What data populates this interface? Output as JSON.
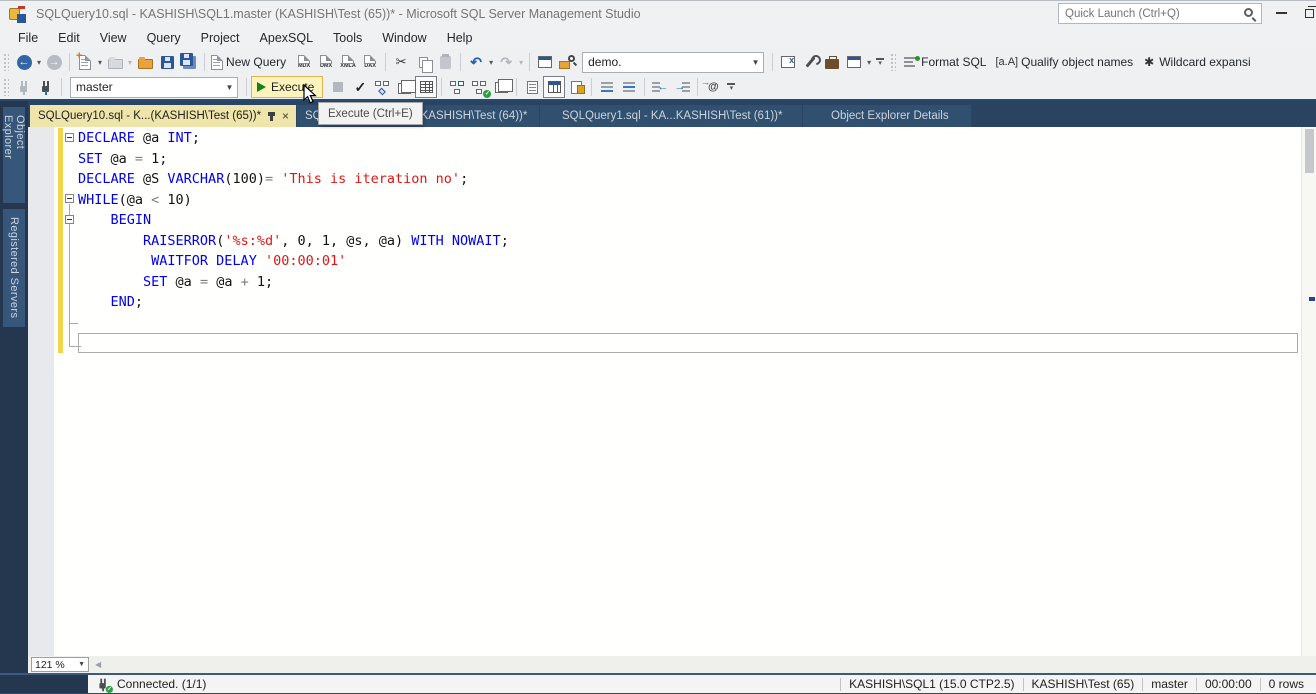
{
  "window": {
    "title": "SQLQuery10.sql - KASHISH\\SQL1.master (KASHISH\\Test (65))* - Microsoft SQL Server Management Studio",
    "quick_launch_placeholder": "Quick Launch (Ctrl+Q)"
  },
  "menu": {
    "items": [
      "File",
      "Edit",
      "View",
      "Query",
      "Project",
      "ApexSQL",
      "Tools",
      "Window",
      "Help"
    ]
  },
  "toolbar1": {
    "new_query": "New Query",
    "query_types": [
      "MDX",
      "DMX",
      "XMLA",
      "DAX"
    ],
    "database_value": "demo.",
    "format_sql": "Format SQL",
    "qualify_icon": "[a.A]",
    "qualify": "Qualify object names",
    "wildcard_icon": "✱",
    "wildcard": "Wildcard expansi"
  },
  "toolbar2": {
    "database_value": "master",
    "execute": "Execute"
  },
  "tooltip": {
    "text": "Execute (Ctrl+E)"
  },
  "tabs": {
    "active": "SQLQuery10.sql - K...(KASHISH\\Test (65))*",
    "tab2_start": "SQ",
    "tab2_end": "KASHISH\\Test (64))*",
    "tab3": "SQLQuery1.sql - KA...KASHISH\\Test (61))*",
    "tab4": "Object Explorer Details"
  },
  "sidebar": {
    "items": [
      "Object Explorer",
      "Registered Servers"
    ]
  },
  "editor": {
    "lines": [
      [
        {
          "c": "k",
          "t": "DECLARE"
        },
        {
          "c": "p",
          "t": " @a "
        },
        {
          "c": "k",
          "t": "INT"
        },
        {
          "c": "p",
          "t": ";"
        }
      ],
      [
        {
          "c": "k",
          "t": "SET"
        },
        {
          "c": "p",
          "t": " @a "
        },
        {
          "c": "o",
          "t": "="
        },
        {
          "c": "p",
          "t": " 1;"
        }
      ],
      [
        {
          "c": "k",
          "t": "DECLARE"
        },
        {
          "c": "p",
          "t": " @S "
        },
        {
          "c": "k",
          "t": "VARCHAR"
        },
        {
          "c": "p",
          "t": "(100)"
        },
        {
          "c": "o",
          "t": "="
        },
        {
          "c": "p",
          "t": " "
        },
        {
          "c": "s",
          "t": "'This is iteration no'"
        },
        {
          "c": "p",
          "t": ";"
        }
      ],
      [
        {
          "c": "k",
          "t": "WHILE"
        },
        {
          "c": "p",
          "t": "(@a "
        },
        {
          "c": "o",
          "t": "<"
        },
        {
          "c": "p",
          "t": " 10)"
        }
      ],
      [
        {
          "c": "p",
          "t": "    "
        },
        {
          "c": "k",
          "t": "BEGIN"
        }
      ],
      [
        {
          "c": "p",
          "t": "        "
        },
        {
          "c": "k",
          "t": "RAISERROR"
        },
        {
          "c": "p",
          "t": "("
        },
        {
          "c": "s",
          "t": "'%s:%d'"
        },
        {
          "c": "p",
          "t": ", 0, 1, @s, @a) "
        },
        {
          "c": "k",
          "t": "WITH NOWAIT"
        },
        {
          "c": "p",
          "t": ";"
        }
      ],
      [
        {
          "c": "p",
          "t": "         "
        },
        {
          "c": "k",
          "t": "WAITFOR DELAY"
        },
        {
          "c": "p",
          "t": " "
        },
        {
          "c": "s",
          "t": "'00:00:01'"
        }
      ],
      [
        {
          "c": "p",
          "t": "        "
        },
        {
          "c": "k",
          "t": "SET"
        },
        {
          "c": "p",
          "t": " @a "
        },
        {
          "c": "o",
          "t": "="
        },
        {
          "c": "p",
          "t": " @a "
        },
        {
          "c": "o",
          "t": "+"
        },
        {
          "c": "p",
          "t": " 1;"
        }
      ],
      [
        {
          "c": "p",
          "t": "    "
        },
        {
          "c": "k",
          "t": "END"
        },
        {
          "c": "p",
          "t": ";"
        }
      ]
    ]
  },
  "scrollbar": {
    "zoom_value": "121 %"
  },
  "statusbar": {
    "connected": "Connected. (1/1)",
    "items": [
      "KASHISH\\SQL1 (15.0 CTP2.5)",
      "KASHISH\\Test (65)",
      "master",
      "00:00:00",
      "0 rows"
    ]
  },
  "colors": {
    "active_tab": "#efe4a9",
    "tabstrip": "#2a4360",
    "sidebar": "#24374f",
    "keyword": "#0000f0",
    "string": "#e01616",
    "operator": "#7e7e7e",
    "change_bar": "#f0d64a",
    "execute_hover": "#fdf3bd"
  }
}
